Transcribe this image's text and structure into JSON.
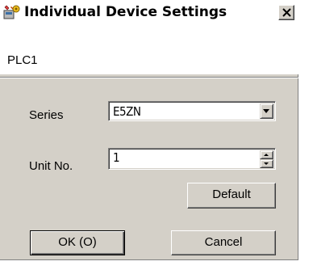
{
  "dialog": {
    "title": "Individual Device Settings",
    "device_name": "PLC1"
  },
  "form": {
    "series_label": "Series",
    "series_value": "E5ZN",
    "unit_label": "Unit No.",
    "unit_value": "1"
  },
  "buttons": {
    "default_label": "Default",
    "ok_label": "OK (O)",
    "cancel_label": "Cancel"
  },
  "icons": {
    "title": "device-settings-icon",
    "close": "close-icon",
    "dropdown": "triangle-down-icon",
    "spin_up": "spin-up-icon",
    "spin_down": "spin-down-icon"
  },
  "colors": {
    "dialog_face": "#d4d0c8",
    "title_background": "#ffffff"
  }
}
